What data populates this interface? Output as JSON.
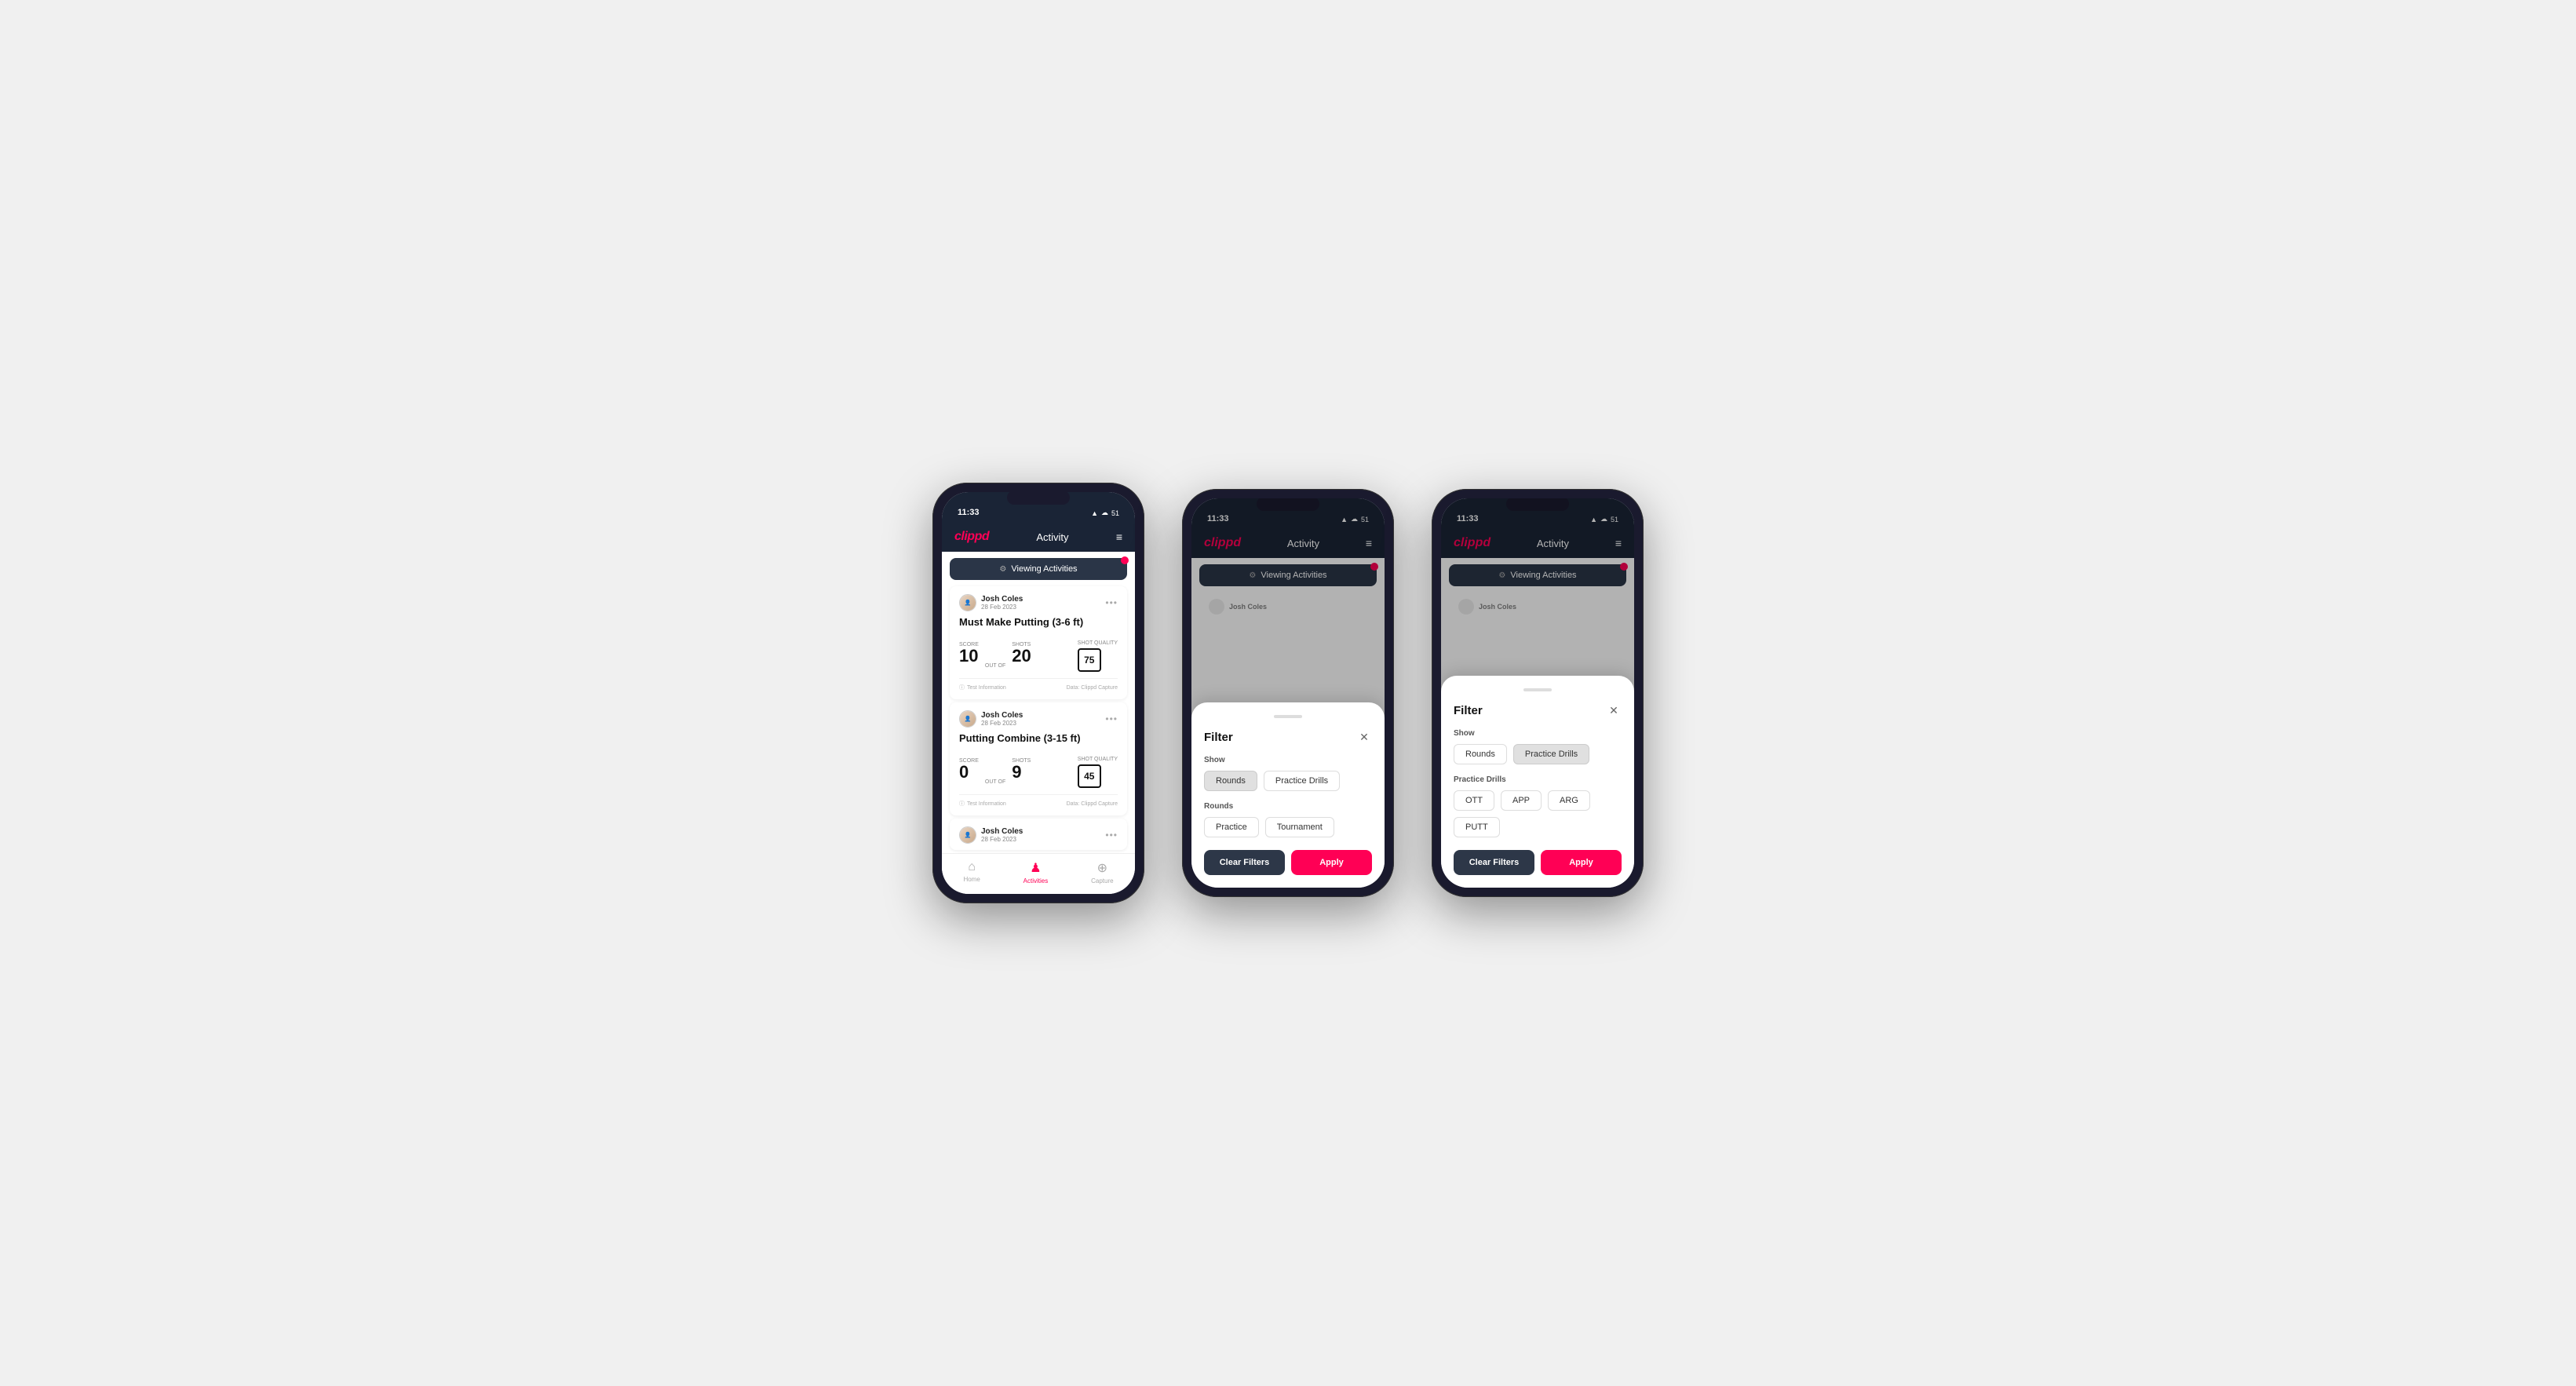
{
  "colors": {
    "brand": "#ff0055",
    "darkNav": "#1a2436",
    "darkCard": "#2a3547",
    "clearBtn": "#2d3748",
    "applyBtn": "#ff0055"
  },
  "phones": [
    {
      "id": "phone1",
      "statusBar": {
        "time": "11:33",
        "icons": "▲ ☁ 51"
      },
      "nav": {
        "logo": "clippd",
        "title": "Activity",
        "menuIcon": "≡"
      },
      "viewingBanner": "Viewing Activities",
      "activities": [
        {
          "userName": "Josh Coles",
          "date": "28 Feb 2023",
          "title": "Must Make Putting (3-6 ft)",
          "scoreLabel": "Score",
          "scoreValue": "10",
          "outof": "OUT OF",
          "shotsLabel": "Shots",
          "shotsValue": "20",
          "qualityLabel": "Shot Quality",
          "qualityValue": "75",
          "footerLeft": "Test Information",
          "footerRight": "Data: Clippd Capture"
        },
        {
          "userName": "Josh Coles",
          "date": "28 Feb 2023",
          "title": "Putting Combine (3-15 ft)",
          "scoreLabel": "Score",
          "scoreValue": "0",
          "outof": "OUT OF",
          "shotsLabel": "Shots",
          "shotsValue": "9",
          "qualityLabel": "Shot Quality",
          "qualityValue": "45",
          "footerLeft": "Test Information",
          "footerRight": "Data: Clippd Capture"
        },
        {
          "userName": "Josh Coles",
          "date": "28 Feb 2023",
          "title": "",
          "scoreLabel": "",
          "scoreValue": "",
          "outof": "",
          "shotsLabel": "",
          "shotsValue": "",
          "qualityLabel": "",
          "qualityValue": "",
          "footerLeft": "",
          "footerRight": ""
        }
      ],
      "tabs": [
        {
          "label": "Home",
          "icon": "⌂",
          "active": false
        },
        {
          "label": "Activities",
          "icon": "♟",
          "active": true
        },
        {
          "label": "Capture",
          "icon": "⊕",
          "active": false
        }
      ]
    },
    {
      "id": "phone2",
      "filter": {
        "title": "Filter",
        "showLabel": "Show",
        "showButtons": [
          {
            "label": "Rounds",
            "active": true
          },
          {
            "label": "Practice Drills",
            "active": false
          }
        ],
        "roundsLabel": "Rounds",
        "roundsButtons": [
          {
            "label": "Practice",
            "active": false
          },
          {
            "label": "Tournament",
            "active": false
          }
        ],
        "clearLabel": "Clear Filters",
        "applyLabel": "Apply"
      }
    },
    {
      "id": "phone3",
      "filter": {
        "title": "Filter",
        "showLabel": "Show",
        "showButtons": [
          {
            "label": "Rounds",
            "active": false
          },
          {
            "label": "Practice Drills",
            "active": true
          }
        ],
        "practiceLabel": "Practice Drills",
        "practiceButtons": [
          {
            "label": "OTT",
            "active": false
          },
          {
            "label": "APP",
            "active": false
          },
          {
            "label": "ARG",
            "active": false
          },
          {
            "label": "PUTT",
            "active": false
          }
        ],
        "clearLabel": "Clear Filters",
        "applyLabel": "Apply"
      }
    }
  ]
}
